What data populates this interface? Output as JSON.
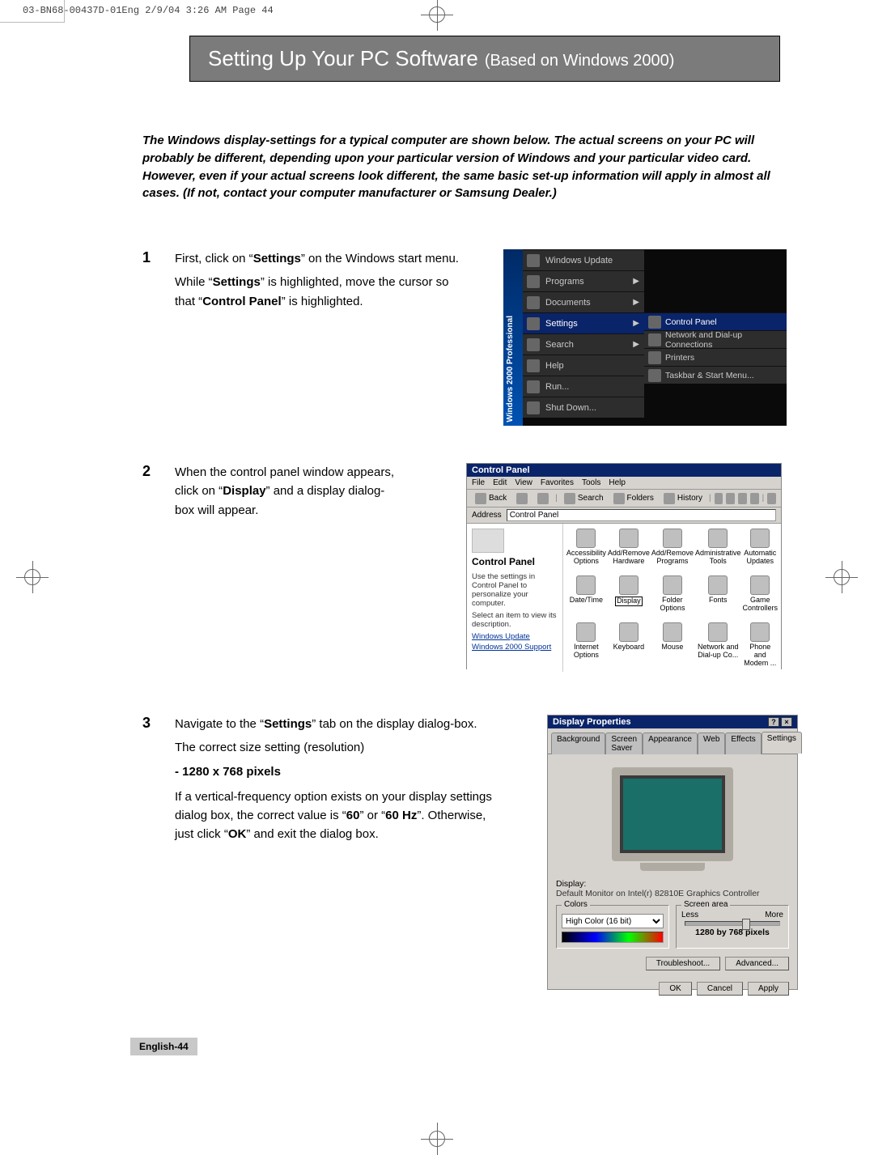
{
  "print_header": "03-BN68-00437D-01Eng  2/9/04  3:26 AM  Page 44",
  "title": {
    "main": "Setting Up Your PC Software",
    "sub": "(Based on Windows 2000)"
  },
  "intro": "The Windows display-settings for a typical computer are shown below. The actual screens on your PC will probably be different, depending upon your particular version of Windows and your particular video card. However, even if your actual screens look different, the same basic set-up information will apply in almost all cases. (If not, contact your computer manufacturer or Samsung Dealer.)",
  "steps": {
    "s1": {
      "num": "1",
      "p1a": "First, click on “",
      "p1b": "Settings",
      "p1c": "” on the Windows start menu.",
      "p2a": "While “",
      "p2b": "Settings",
      "p2c": "” is highlighted, move the cursor so that “",
      "p2d": "Control Panel",
      "p2e": "” is highlighted."
    },
    "s2": {
      "num": "2",
      "p1a": "When the control panel window appears, click on “",
      "p1b": "Display",
      "p1c": "” and a display dialog-box will appear."
    },
    "s3": {
      "num": "3",
      "p1a": "Navigate to the “",
      "p1b": "Settings",
      "p1c": "” tab on the display dialog-box.",
      "p2": "The correct size setting (resolution)",
      "p3": "- 1280 x 768 pixels",
      "p4a": "If a vertical-frequency option exists on your display settings dialog box, the correct value is “",
      "p4b": "60",
      "p4c": "” or “",
      "p4d": "60 Hz",
      "p4e": "”. Otherwise, just click “",
      "p4f": "OK",
      "p4g": "” and exit the dialog box."
    }
  },
  "startmenu": {
    "sidebar": "Windows 2000 Professional",
    "items": [
      "Windows Update",
      "Programs",
      "Documents",
      "Settings",
      "Search",
      "Help",
      "Run...",
      "Shut Down..."
    ],
    "sub": [
      "Control Panel",
      "Network and Dial-up Connections",
      "Printers",
      "Taskbar & Start Menu..."
    ]
  },
  "cp": {
    "title": "Control Panel",
    "menu": [
      "File",
      "Edit",
      "View",
      "Favorites",
      "Tools",
      "Help"
    ],
    "toolbar": {
      "back": "Back",
      "search": "Search",
      "folders": "Folders",
      "history": "History"
    },
    "addr_label": "Address",
    "addr_value": "Control Panel",
    "side": {
      "heading": "Control Panel",
      "p1": "Use the settings in Control Panel to personalize your computer.",
      "p2": "Select an item to view its description.",
      "l1": "Windows Update",
      "l2": "Windows 2000 Support"
    },
    "icons": [
      "Accessibility Options",
      "Add/Remove Hardware",
      "Add/Remove Programs",
      "Administrative Tools",
      "Automatic Updates",
      "Date/Time",
      "Display",
      "Folder Options",
      "Fonts",
      "Game Controllers",
      "Internet Options",
      "Keyboard",
      "Mouse",
      "Network and Dial-up Co...",
      "Phone and Modem ..."
    ]
  },
  "dp": {
    "title": "Display Properties",
    "tabs": [
      "Background",
      "Screen Saver",
      "Appearance",
      "Web",
      "Effects",
      "Settings"
    ],
    "display_label": "Display:",
    "display_value": "Default Monitor on Intel(r) 82810E Graphics Controller",
    "colors_label": "Colors",
    "colors_value": "High Color (16 bit)",
    "area_label": "Screen area",
    "less": "Less",
    "more": "More",
    "resolution": "1280 by 768 pixels",
    "btn_trouble": "Troubleshoot...",
    "btn_adv": "Advanced...",
    "ok": "OK",
    "cancel": "Cancel",
    "apply": "Apply"
  },
  "footer": "English-44"
}
